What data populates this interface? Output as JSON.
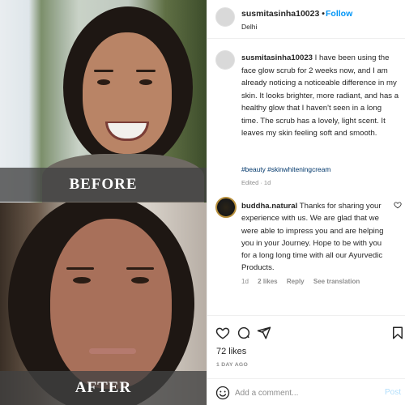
{
  "before_image": {
    "label": "BEFORE"
  },
  "after_image": {
    "label": "AFTER"
  },
  "post": {
    "username": "susmitasinha10023",
    "separator": "•",
    "follow_label": "Follow",
    "location": "Delhi",
    "caption": {
      "username": "susmitasinha10023",
      "text": "I have been using the face glow scrub for 2 weeks now, and I am already noticing a noticeable difference in my skin. It looks brighter, more radiant, and has a healthy glow that I haven't seen in a long time. The scrub has a lovely, light scent. It leaves my skin feeling soft and smooth.",
      "hashtags": "#beauty #skinwhiteningcream",
      "edited": "Edited · 1d"
    },
    "reply": {
      "username": "buddha.natural",
      "text": "Thanks for sharing your experience with us. We are glad that we were able to impress you and are helping you in your Journey. Hope to be with you for a long long time with all our Ayurvedic Products.",
      "time": "1d",
      "likes": "2 likes",
      "reply_label": "Reply",
      "translation_label": "See translation"
    },
    "likes": "72 likes",
    "posted": "1 DAY AGO",
    "comment_placeholder": "Add a comment...",
    "post_label": "Post"
  },
  "colors": {
    "follow_blue": "#0095f6",
    "post_disabled_blue": "#b2dffc",
    "hashtag_blue": "#00376b",
    "muted_gray": "#8e8e8e",
    "label_band": "#414141"
  },
  "icons": [
    "heart-icon",
    "comment-icon",
    "share-icon",
    "bookmark-icon",
    "emoji-icon",
    "heart-small-icon"
  ]
}
